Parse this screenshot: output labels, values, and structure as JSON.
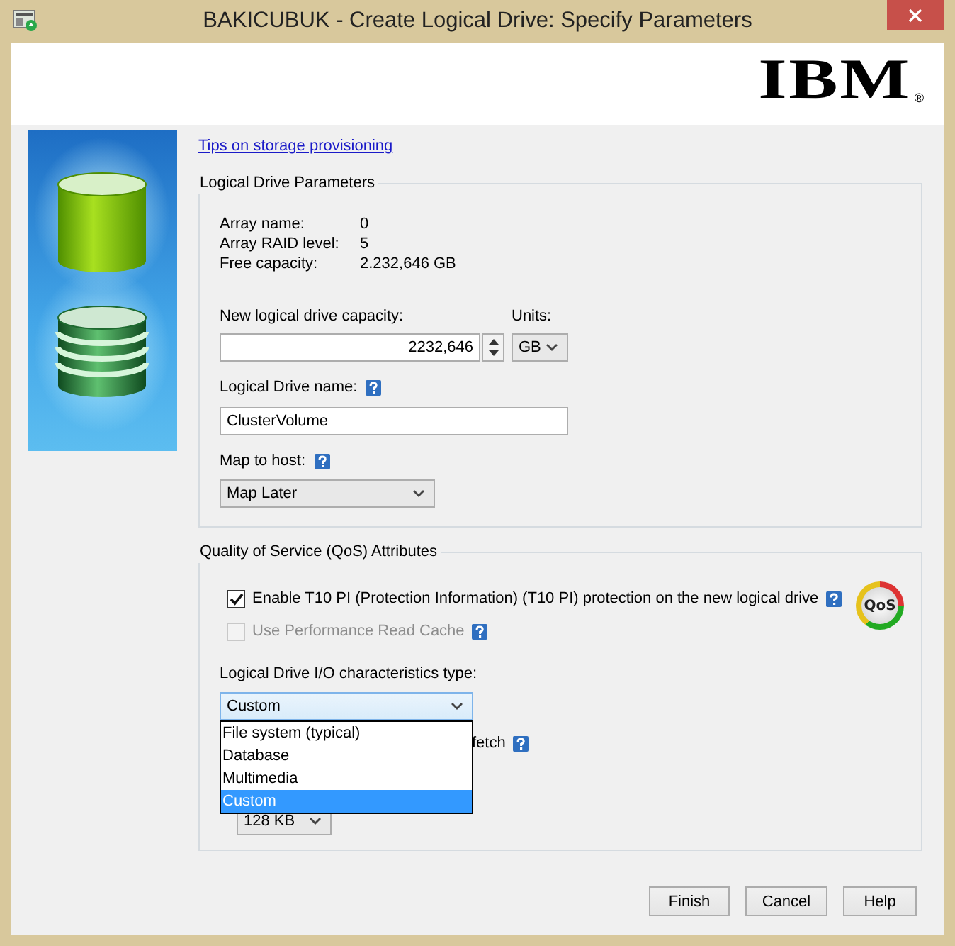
{
  "window": {
    "title": "BAKICUBUK - Create Logical Drive: Specify Parameters",
    "logo": "IBM",
    "logo_mark": "®"
  },
  "tips_link": "Tips on storage provisioning",
  "parameters": {
    "title": "Logical Drive Parameters",
    "info": [
      {
        "label": "Array name:",
        "value": "0"
      },
      {
        "label": "Array RAID level:",
        "value": "5"
      },
      {
        "label": "Free capacity:",
        "value": "2.232,646 GB"
      }
    ],
    "capacity": {
      "label": "New logical drive capacity:",
      "value": "2232,646"
    },
    "units": {
      "label": "Units:",
      "value": "GB"
    },
    "drive_name": {
      "label": "Logical Drive name:",
      "value": "ClusterVolume",
      "help": true
    },
    "map_host": {
      "label": "Map to host:",
      "value": "Map Later",
      "help": true
    }
  },
  "qos": {
    "title": "Quality of Service (QoS) Attributes",
    "badge": "QoS",
    "options": [
      {
        "label": "Enable T10 PI (Protection Information) (T10 PI) protection on the new logical drive",
        "checked": true,
        "disabled": false,
        "help": true
      },
      {
        "label": "Use Performance Read Cache",
        "checked": false,
        "disabled": true,
        "help": true
      }
    ],
    "io_type": {
      "label": "Logical Drive I/O characteristics type:",
      "value": "Custom",
      "expanded": true,
      "options": [
        {
          "label": "File system (typical)",
          "selected": false
        },
        {
          "label": "Database",
          "selected": false
        },
        {
          "label": "Multimedia",
          "selected": false
        },
        {
          "label": "Custom",
          "selected": true
        }
      ]
    },
    "prefetch_label": "fetch",
    "prefetch_help": true,
    "segment_size": "128 KB"
  },
  "buttons": [
    "Finish",
    "Cancel",
    "Help"
  ]
}
